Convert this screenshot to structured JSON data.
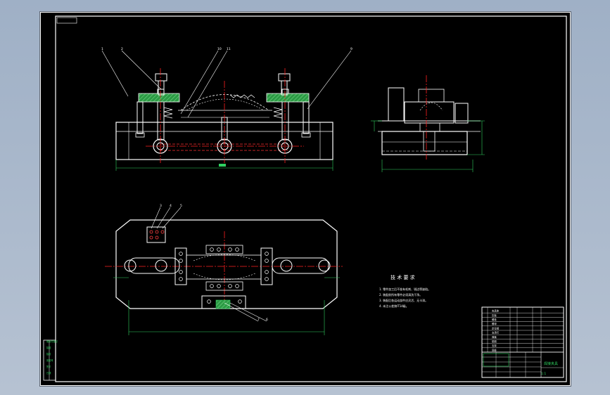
{
  "drawing": {
    "technical_requirements": {
      "title": "技 术 要 求",
      "items": [
        "1. 零件加工后不准有毛刺、锐边等缺陷。",
        "2. 装配前所有零件必须清洗干净。",
        "3. 装配后各运动部件应灵活、无卡滞。",
        "4. 未注公差按IT14级。"
      ]
    },
    "title_block": {
      "drawing_name": "焊接夹具",
      "scale": "1:1",
      "rows": [
        "夹具体",
        "压板",
        "螺栓",
        "螺母",
        "定位销",
        "支承钉",
        "弹簧",
        "垫圈",
        "支架",
        "底板"
      ]
    },
    "side_panel": {
      "labels": [
        "借用件登记",
        "描图",
        "描校",
        "底图号",
        "签字",
        "日期"
      ]
    },
    "balloons_front": [
      "1",
      "2",
      "10",
      "11",
      "9"
    ],
    "balloons_plan": [
      "3",
      "4",
      "5",
      "7",
      "6"
    ],
    "colors": {
      "background": "#000000",
      "outline": "#ffffff",
      "centerline": "#ff2020",
      "section_hatch": "#2fa84f",
      "dimension": "#30d060",
      "bolt": "#e0e0e0"
    }
  }
}
